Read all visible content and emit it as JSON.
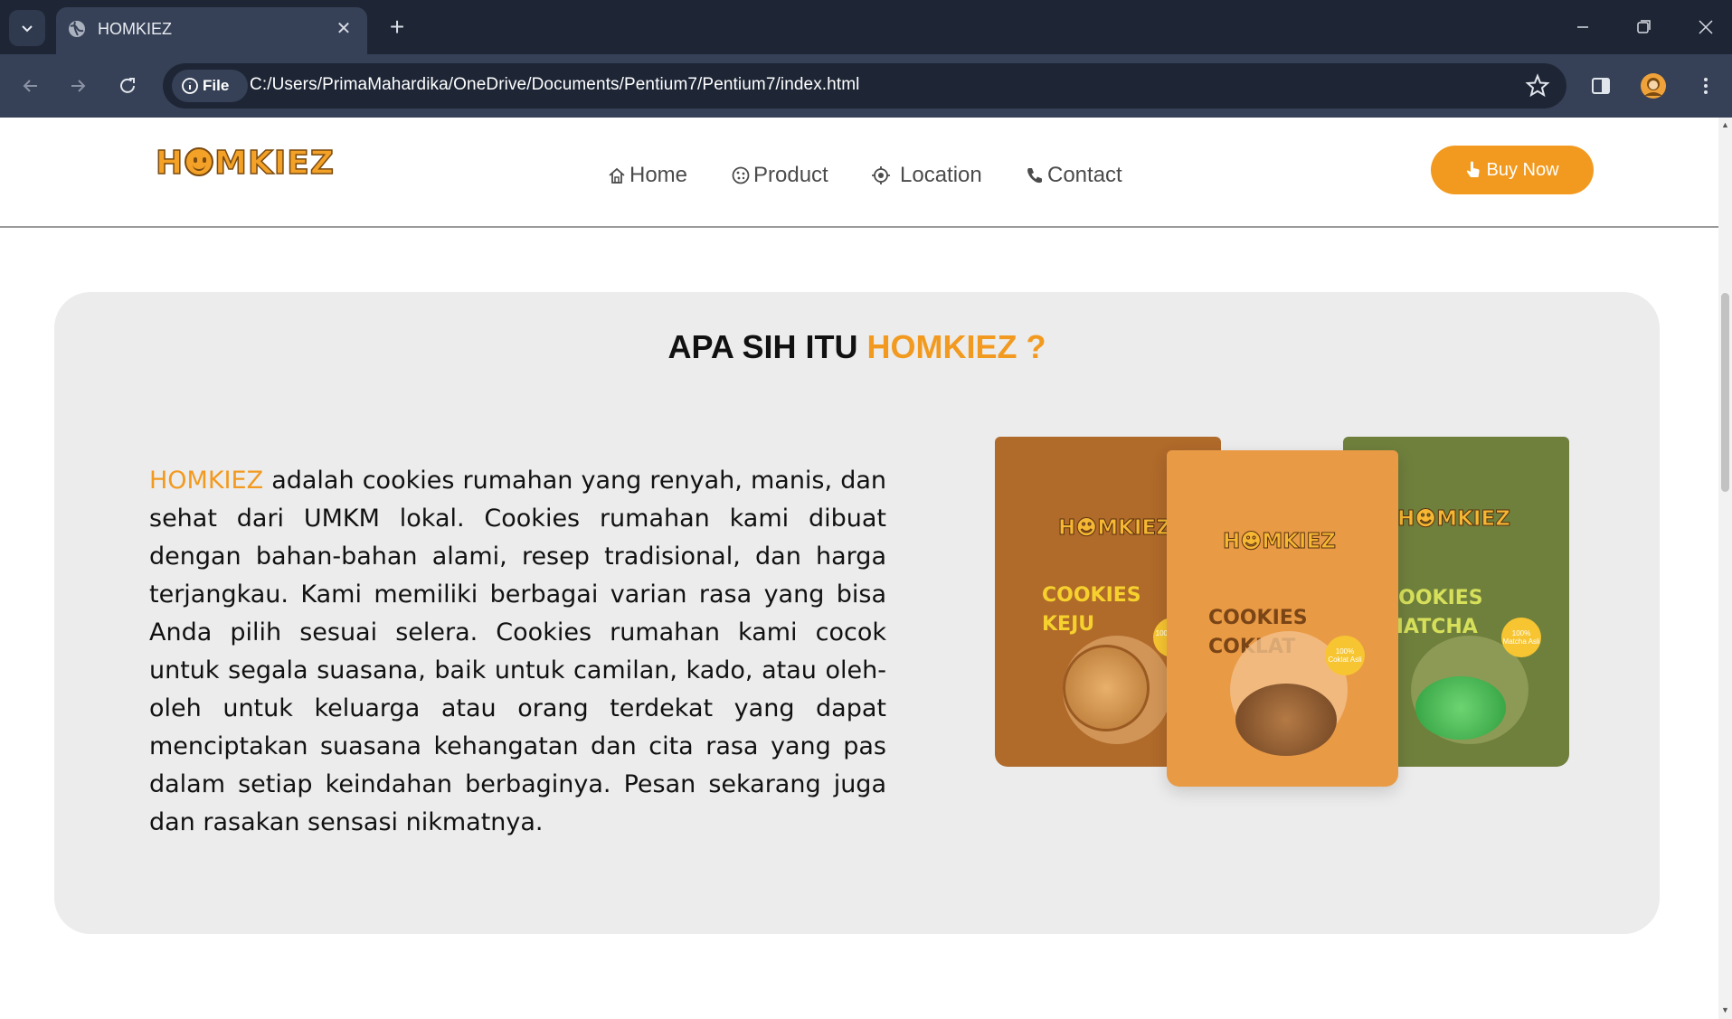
{
  "browser": {
    "tab_title": "HOMKIEZ",
    "site_chip_label": "File",
    "url": "C:/Users/PrimaMahardika/OneDrive/Documents/Pentium7/Pentium7/index.html"
  },
  "nav": {
    "logo_text_before": "H",
    "logo_text_after": "MKIEZ",
    "items": [
      {
        "label": "Home",
        "icon": "home-icon"
      },
      {
        "label": "Product",
        "icon": "cookie-icon"
      },
      {
        "label": "Location",
        "icon": "location-icon"
      },
      {
        "label": "Contact",
        "icon": "phone-icon"
      }
    ],
    "buy_label": "Buy Now",
    "buy_icon": "pointer-hand-icon"
  },
  "about": {
    "title_plain": "APA SIH ITU ",
    "title_accent": "HOMKIEZ ?",
    "brand": "HOMKIEZ",
    "body": " adalah cookies rumahan yang renyah, manis, dan sehat dari UMKM lokal. Cookies rumahan kami dibuat dengan bahan-bahan alami, resep tradisional, dan harga terjangkau. Kami memiliki berbagai varian rasa yang bisa Anda pilih sesuai selera. Cookies rumahan kami cocok untuk segala suasana, baik untuk camilan, kado, atau oleh-oleh untuk keluarga atau orang terdekat yang dapat menciptakan suasana kehangatan dan cita rasa yang pas dalam setiap keindahan berbaginya. Pesan sekarang juga dan rasakan sensasi nikmatnya."
  },
  "packs": [
    {
      "logo": "H☻MKIEZ",
      "name_line1": "COOKIES",
      "name_line2": "KEJU",
      "badge": "100% Keju Asli",
      "color": "#b06a2a",
      "name_color": "#f6d12e"
    },
    {
      "logo": "H☻MKIEZ",
      "name_line1": "COOKIES",
      "name_line2": "COKLAT",
      "badge": "100% Coklat Asli",
      "color": "#e99a45",
      "name_color": "#7a4516"
    },
    {
      "logo": "H☻MKIEZ",
      "name_line1": "COOKIES",
      "name_line2": "MATCHA",
      "badge": "100% Matcha Asli",
      "color": "#6f7f3c",
      "name_color": "#d6e05a"
    }
  ],
  "colors": {
    "accent": "#f29a1f",
    "chrome_dark": "#1e2636",
    "chrome_mid": "#364157",
    "card_bg": "#ececec"
  }
}
